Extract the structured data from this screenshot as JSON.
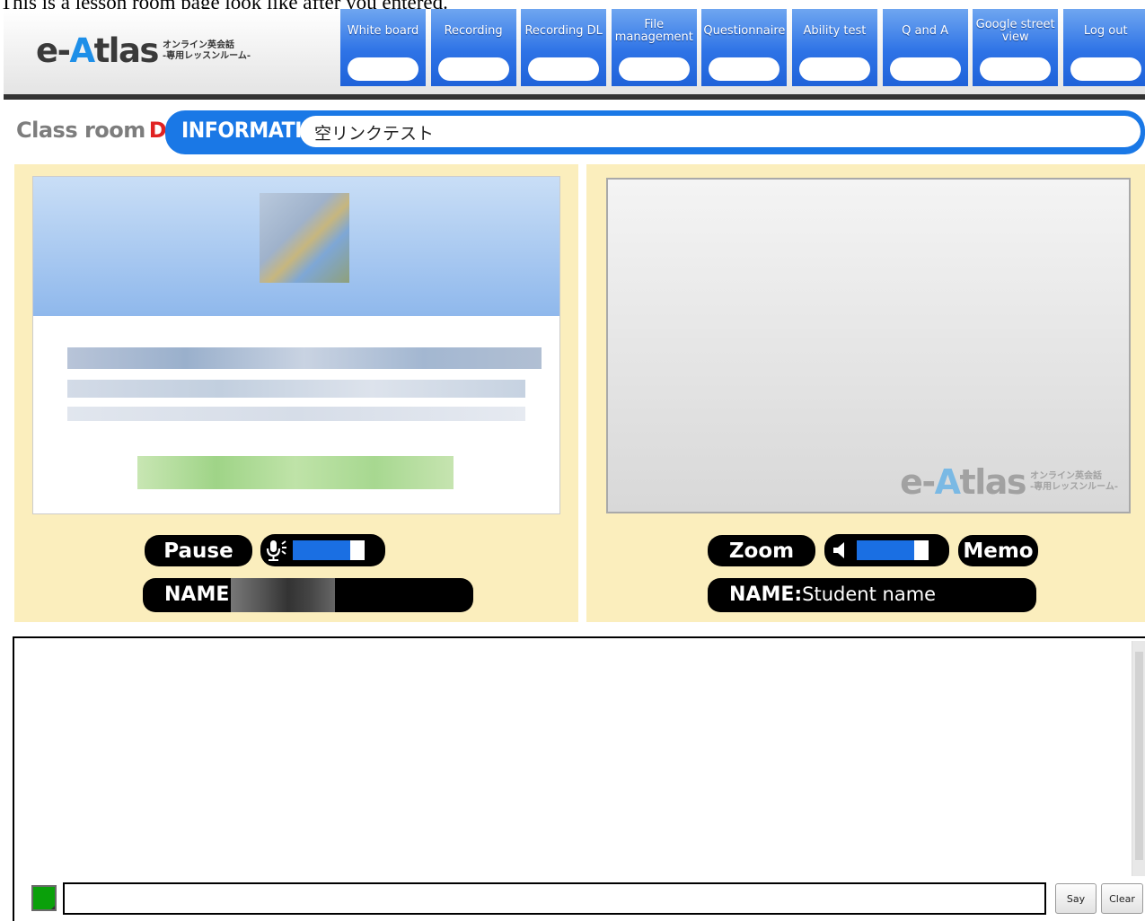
{
  "caption": "This is a lesson room page look like after you entered.",
  "logo": {
    "word_prefix": "e-",
    "word_accent": "A",
    "word_suffix": "tlas",
    "sub_line1": "オンライン英会話",
    "sub_line2": "-専用レッスンルーム-"
  },
  "nav": [
    {
      "label": "White board"
    },
    {
      "label": "Recording"
    },
    {
      "label": "Recording DL"
    },
    {
      "label": "File management"
    },
    {
      "label": "Questionnaire"
    },
    {
      "label": "Ability test"
    },
    {
      "label": "Q and A"
    },
    {
      "label": "Google street view"
    },
    {
      "label": "Log out"
    }
  ],
  "classroom": {
    "label": "Class room",
    "letter": "D"
  },
  "information": {
    "label": "INFORMATION",
    "text": "空リンクテスト"
  },
  "teacher_panel": {
    "pause_label": "Pause",
    "mic_icon": "microphone-icon",
    "mic_level": 0.8,
    "name_label": "NAME:"
  },
  "student_panel": {
    "zoom_label": "Zoom",
    "speaker_icon": "speaker-icon",
    "volume_level": 0.8,
    "memo_label": "Memo",
    "name_label": "NAME:",
    "name_value": "Student name"
  },
  "chat": {
    "input_value": "",
    "say_label": "Say",
    "clear_label": "Clear",
    "color": "#0aa00a"
  },
  "colors": {
    "nav_blue": "#2e73e6",
    "info_blue": "#1a78e6",
    "panel_bg": "#fbeebd",
    "accent_red": "#e02222"
  }
}
